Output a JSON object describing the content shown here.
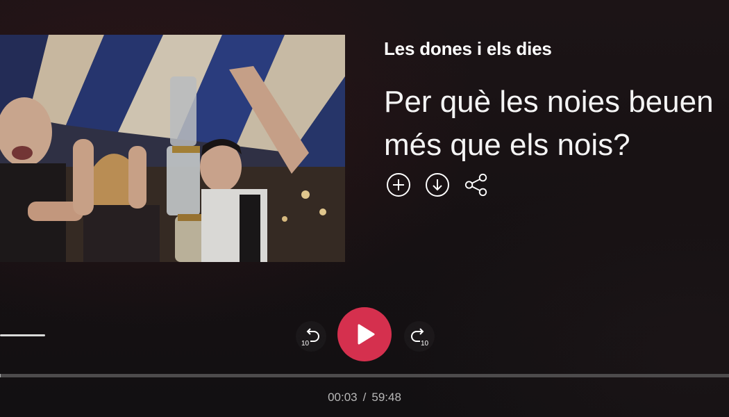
{
  "program": {
    "title": "Les dones i els dies"
  },
  "episode": {
    "title": "Per què les noies beuen més que els nois?"
  },
  "actions": [
    {
      "icon": "plus-circle-icon",
      "label": "Afegir"
    },
    {
      "icon": "download-circle-icon",
      "label": "Descarregar"
    },
    {
      "icon": "share-icon",
      "label": "Compartir"
    }
  ],
  "controls": {
    "skip_back_seconds": "10",
    "skip_forward_seconds": "10",
    "state": "paused"
  },
  "playback": {
    "current_time": "00:03",
    "separator": "/",
    "duration": "59:48",
    "progress_fraction": 0.0008
  },
  "colors": {
    "accent": "#d5304e",
    "background": "#141012",
    "text": "#ffffff",
    "muted_text": "#b8b8b8"
  }
}
